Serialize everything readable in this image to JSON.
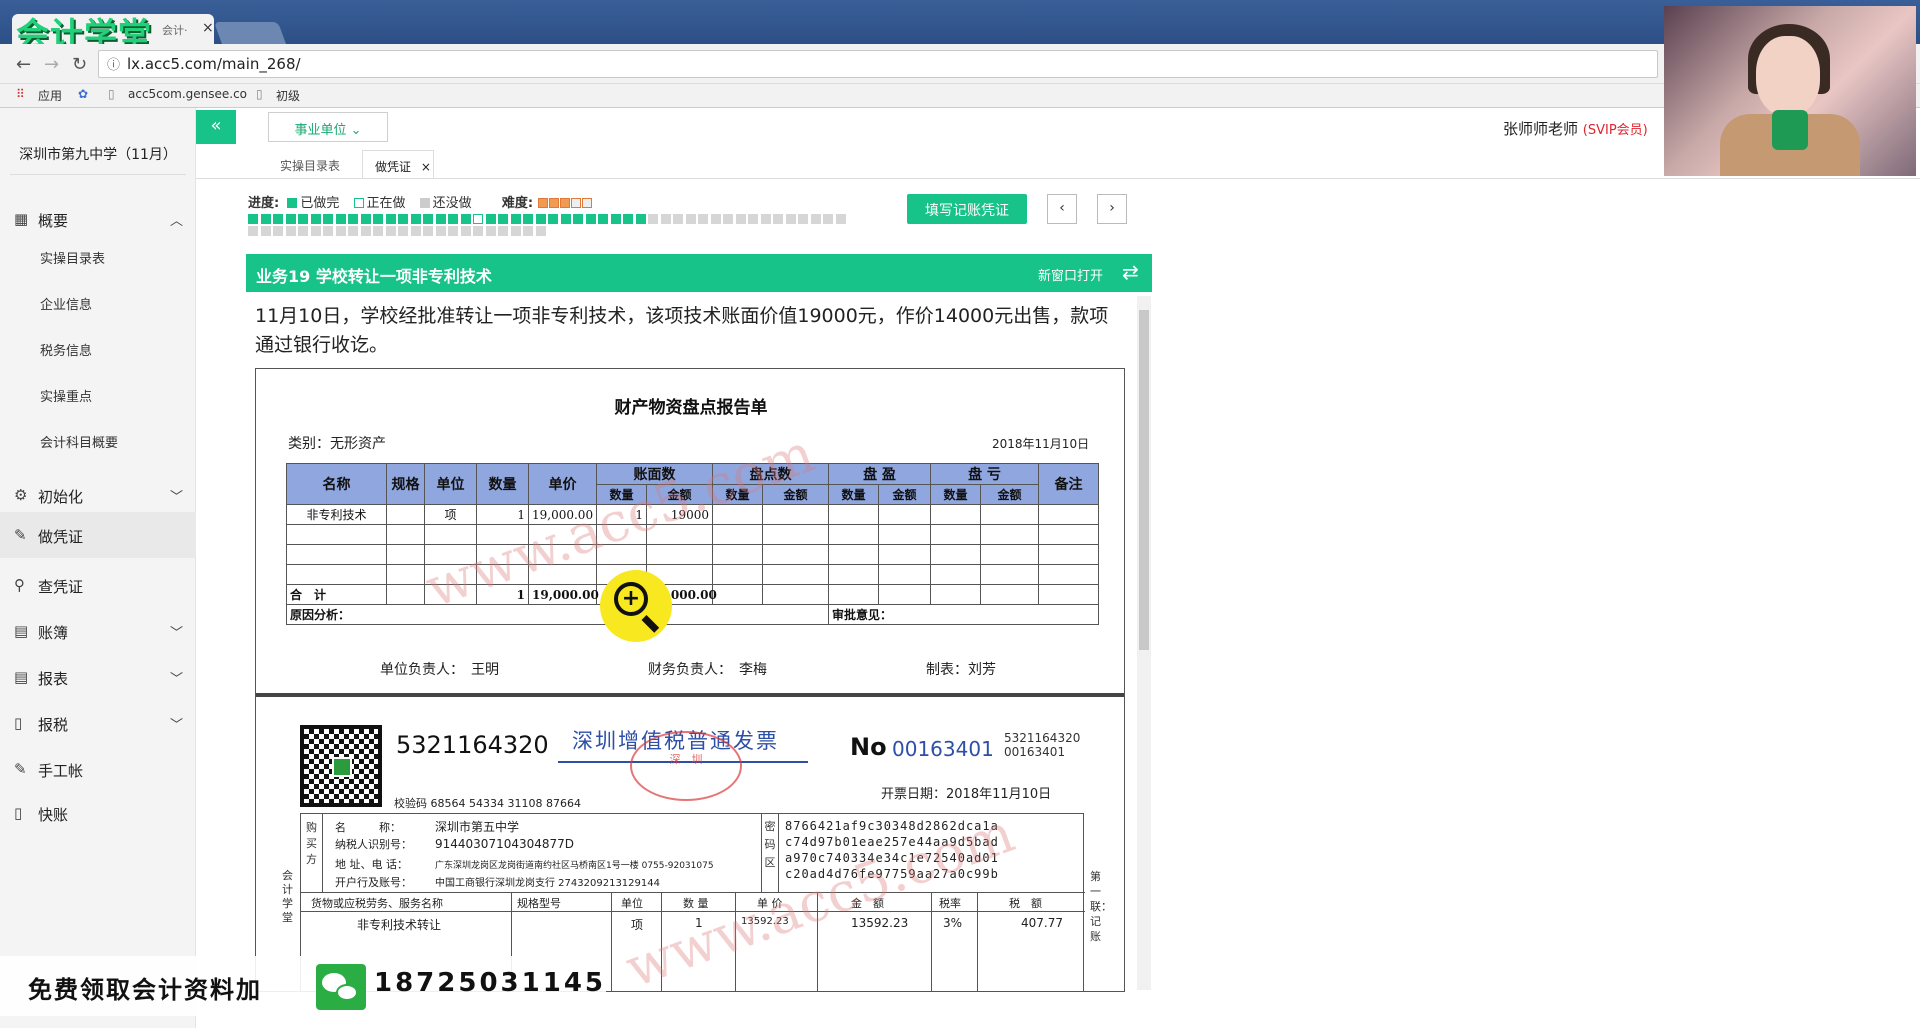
{
  "browser": {
    "tab_title": "会计学堂",
    "tab_short": "会计·",
    "url": "lx.acc5.com/main_268/",
    "bookmarks": [
      "应用",
      "acc5com.gensee.co",
      "初级"
    ]
  },
  "header": {
    "unit_select": "事业单位",
    "teacher": "张师师老师",
    "vip": "(SVIP会员)"
  },
  "sidebar": {
    "org": "深圳市第九中学（11月）",
    "menu": [
      {
        "label": "概要"
      },
      {
        "label": "初始化"
      },
      {
        "label": "做凭证"
      },
      {
        "label": "查凭证"
      },
      {
        "label": "账簿"
      },
      {
        "label": "报表"
      },
      {
        "label": "报税"
      },
      {
        "label": "手工帐"
      },
      {
        "label": "快账"
      }
    ],
    "submenu": [
      "实操目录表",
      "企业信息",
      "税务信息",
      "实操重点",
      "会计科目概要"
    ]
  },
  "subtabs": [
    "实操目录表",
    "做凭证"
  ],
  "progress": {
    "label": "进度:",
    "done": "已做完",
    "doing": "正在做",
    "todo": "还没做",
    "difficulty": "难度:",
    "difficulty_stars": 3,
    "difficulty_max": 5,
    "fill_button": "填写记账凭证",
    "total_tasks": 72,
    "done_tasks": 32,
    "current_task": 19
  },
  "business": {
    "title": "业务19 学校转让一项非专利技术",
    "new_window": "新窗口打开",
    "desc": "11月10日，学校经批准转让一项非专利技术，该项技术账面价值19000元，作价14000元出售，款项通过银行收讫。"
  },
  "inventory": {
    "title": "财产物资盘点报告单",
    "category": "类别：无形资产",
    "date": "2018年11月10日",
    "h_name": "名称",
    "h_spec": "规格",
    "h_unit": "单位",
    "h_qty": "数量",
    "h_price": "单价",
    "h_book": "账面数",
    "h_count": "盘点数",
    "h_surplus": "盘 盈",
    "h_loss": "盘 亏",
    "h_note": "备注",
    "h_sub_qty": "数量",
    "h_sub_amt": "金额",
    "row_name": "非专利技术",
    "row_unit": "项",
    "row_qty": "1",
    "row_price": "19,000.00",
    "row_bq": "1",
    "row_ba": "19000",
    "total_label": "合　计",
    "total_qty": "1",
    "total_price": "19,000.00",
    "total_bq": "1",
    "total_ba": "19,000.00",
    "cause": "原因分析：",
    "approve": "审批意见：",
    "sign_unit": "单位负责人：　王明",
    "sign_fin": "财务负责人：　李梅",
    "sign_make": "制表：刘芳",
    "watermark": "www.acc5.com"
  },
  "invoice": {
    "code": "5321164320",
    "name": "深圳增值税普通发票",
    "seal": "深　圳",
    "no_label": "No",
    "no": "00163401",
    "no_small_1": "5321164320",
    "no_small_2": "00163401",
    "issue_date": "开票日期：2018年11月10日",
    "check_code": "校验码 68564 54334 31108 87664",
    "buyer_side": "购买方",
    "buyer_name_label": "名　　　称：",
    "buyer_name": "深圳市第五中学",
    "buyer_tax_label": "纳税人识别号：",
    "buyer_tax": "91440307104304877D",
    "buyer_addr_label": "地 址、电 话：",
    "buyer_addr": "广东深圳龙岗区龙岗街道南约社区马桥南区1号一楼 0755-92031075",
    "buyer_bank_label": "开户行及账号：",
    "buyer_bank": "中国工商银行深圳龙岗支行 2743209213129144",
    "pwd_side": "密码区",
    "pwd_1": "8766421af9c30348d2862dca1a",
    "pwd_2": "c74d97b01eae257e44aa9d5bad",
    "pwd_3": "a970c740334e34c1e72540ad01",
    "pwd_4": "c20ad4d76fe97759aa27a0c99b",
    "gh_name": "货物或应税劳务、服务名称",
    "gh_spec": "规格型号",
    "gh_unit": "单位",
    "gh_qty": "数 量",
    "gh_price": "单 价",
    "gh_amt": "金　额",
    "gh_rate": "税率",
    "gh_tax": "税　额",
    "g_name": "非专利技术转让",
    "g_unit": "项",
    "g_qty": "1",
    "g_price": "13592.23",
    "g_amt": "13592.23",
    "g_rate": "3%",
    "g_tax": "407.77",
    "side_left": "会计学堂",
    "side_right": "第一联：记账"
  },
  "promo": {
    "text": "免费领取会计资料加",
    "phone": "18725031145"
  }
}
